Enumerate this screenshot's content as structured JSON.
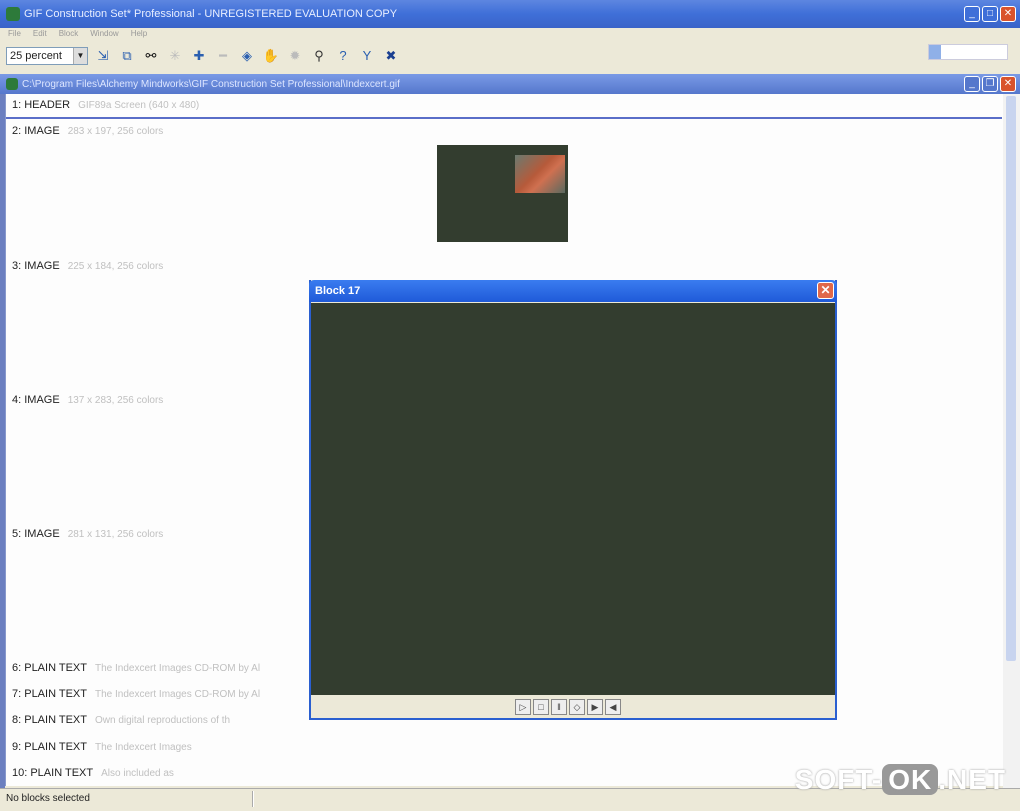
{
  "app_title": "GIF Construction Set* Professional - UNREGISTERED EVALUATION COPY",
  "menu": [
    "File",
    "Edit",
    "Block",
    "Window",
    "Help"
  ],
  "toolbar": {
    "zoom": "25 percent"
  },
  "document_title": "C:\\Program Files\\Alchemy Mindworks\\GIF Construction Set Professional\\Indexcert.gif",
  "blocks": [
    {
      "label": "1: HEADER",
      "detail": "GIF89a Screen (640 x 480)"
    },
    {
      "label": "2: IMAGE",
      "detail": "283 x 197, 256 colors"
    },
    {
      "label": "3: IMAGE",
      "detail": "225 x 184, 256 colors"
    },
    {
      "label": "4: IMAGE",
      "detail": "137 x 283, 256 colors"
    },
    {
      "label": "5: IMAGE",
      "detail": "281 x 131, 256 colors"
    },
    {
      "label": "6: PLAIN TEXT",
      "detail": "The Indexcert Images CD-ROM by Al"
    },
    {
      "label": "7: PLAIN TEXT",
      "detail": "The Indexcert Images CD-ROM by Al"
    },
    {
      "label": "8: PLAIN TEXT",
      "detail": "Own digital reproductions of th"
    },
    {
      "label": "9: PLAIN TEXT",
      "detail": "The Indexcert Images"
    },
    {
      "label": "10: PLAIN TEXT",
      "detail": "Also included as"
    }
  ],
  "dialog": {
    "title": "Block 17"
  },
  "status": "No blocks selected",
  "watermark": {
    "a": "SOFT-",
    "b": "OK",
    ".c": "",
    "c": ".NET"
  }
}
